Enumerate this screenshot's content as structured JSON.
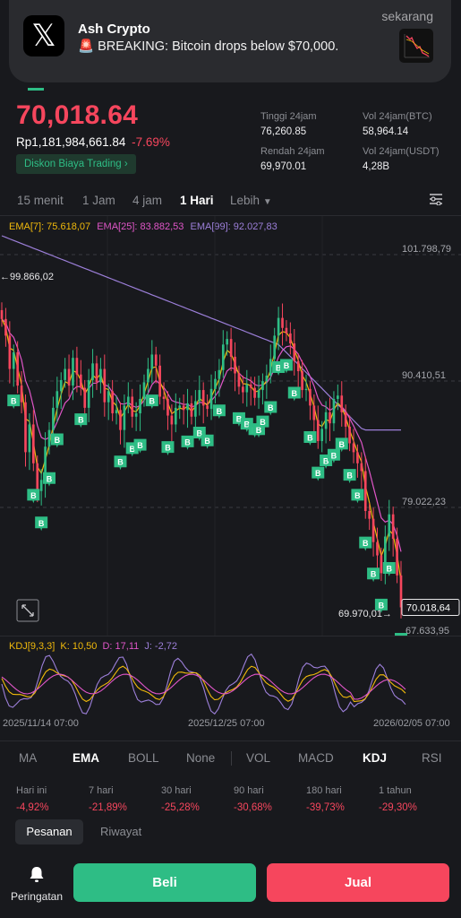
{
  "notification": {
    "title": "Ash Crypto",
    "body": "🚨 BREAKING: Bitcoin drops below $70,000.",
    "time": "sekarang",
    "app_icon": "x-logo"
  },
  "ticker": {
    "price": "70,018.64",
    "idr_price": "Rp1,181,984,661.84",
    "change_pct": "-7.69%",
    "discount_label": "Diskon Biaya Trading",
    "stats": {
      "high_label": "Tinggi 24jam",
      "high": "76,260.85",
      "low_label": "Rendah 24jam",
      "low": "69,970.01",
      "vol_btc_label": "Vol 24jam(BTC)",
      "vol_btc": "58,964.14",
      "vol_usdt_label": "Vol 24jam(USDT)",
      "vol_usdt": "4,28B"
    }
  },
  "timeframes": [
    "15 menit",
    "1 Jam",
    "4 jam",
    "1 Hari",
    "Lebih"
  ],
  "active_timeframe": "1 Hari",
  "ema": {
    "ema7_label": "EMA[7]: 75.618,07",
    "ema25_label": "EMA[25]: 83.882,53",
    "ema99_label": "EMA[99]: 92.027,83"
  },
  "price_axis": {
    "levels": [
      "101.798,79",
      "90.410,51",
      "79.022,23"
    ],
    "left_high_marker": "99.866,02",
    "low_marker": "69.970,01",
    "current_price": "70.018,64",
    "bottom_level": "67.633,95"
  },
  "trade_marker_label": "B",
  "kdj": {
    "label": "KDJ[9,3,3]",
    "k": "K: 10,50",
    "d": "D: 17,11",
    "j": "J: -2,72"
  },
  "dates": [
    "2025/11/14 07:00",
    "2025/12/25 07:00",
    "2026/02/05 07:00"
  ],
  "indicators": [
    "MA",
    "EMA",
    "BOLL",
    "None",
    "VOL",
    "MACD",
    "KDJ",
    "RSI"
  ],
  "active_indicators": [
    "EMA",
    "KDJ"
  ],
  "performance": [
    {
      "period": "Hari ini",
      "value": "-4,92%"
    },
    {
      "period": "7 hari",
      "value": "-21,89%"
    },
    {
      "period": "30 hari",
      "value": "-25,28%"
    },
    {
      "period": "90 hari",
      "value": "-30,68%"
    },
    {
      "period": "180 hari",
      "value": "-39,73%"
    },
    {
      "period": "1 tahun",
      "value": "-29,30%"
    }
  ],
  "order_tabs": [
    "Pesanan",
    "Riwayat"
  ],
  "bottom": {
    "alert_label": "Peringatan",
    "buy_label": "Beli",
    "sell_label": "Jual"
  },
  "colors": {
    "up": "#2ebd85",
    "down": "#f6465d",
    "ema7": "#f0b90b",
    "ema25": "#e056c8",
    "ema99": "#9c7fd9",
    "background": "#18191d"
  },
  "chart_data": {
    "type": "candlestick",
    "x_start": "2025/11/14",
    "x_end": "2026/02/05",
    "y_range": [
      67633.95,
      103500
    ],
    "ohlc_close": [
      96000,
      94500,
      91500,
      93000,
      90000,
      88500,
      84000,
      86500,
      83000,
      80500,
      81500,
      84500,
      86000,
      88000,
      89500,
      90500,
      91500,
      90000,
      92500,
      91000,
      89800,
      88000,
      90500,
      92000,
      90300,
      91500,
      88500,
      89500,
      87500,
      87800,
      86000,
      88200,
      89000,
      87200,
      87500,
      88800,
      90300,
      91500,
      92800,
      91800,
      89000,
      88800,
      87300,
      86500,
      88000,
      88200,
      87800,
      88400,
      87200,
      88600,
      89600,
      88200,
      87900,
      89700,
      90600,
      91400,
      93700,
      94200,
      92600,
      91100,
      89900,
      89400,
      90100,
      89800,
      88900,
      89600,
      90400,
      90900,
      92400,
      94500,
      96100,
      95200,
      94700,
      93800,
      92200,
      91300,
      89600,
      89700,
      88200,
      86900,
      85000,
      86100,
      87600,
      86600,
      88800,
      89100,
      87600,
      86300,
      84800,
      84000,
      83000,
      82300,
      78700,
      78000,
      75900,
      74700,
      73100,
      76400,
      78400,
      76200,
      72900,
      70018.64
    ]
  }
}
